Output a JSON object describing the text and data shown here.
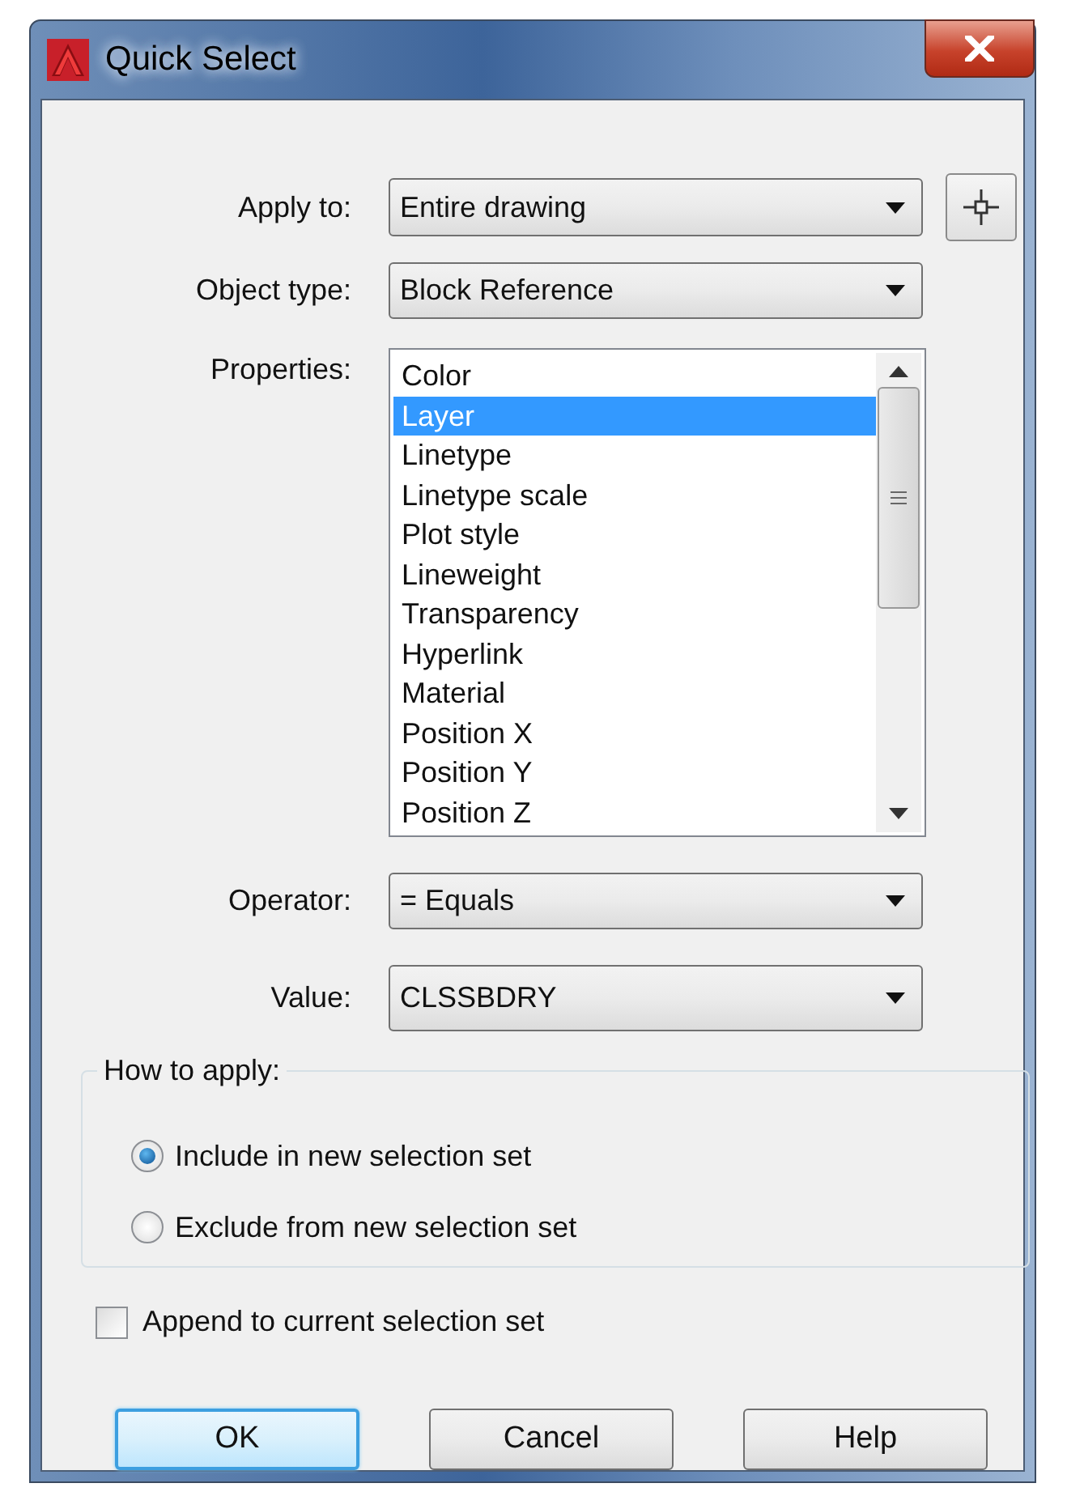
{
  "window": {
    "title": "Quick Select"
  },
  "apply_to": {
    "label": "Apply to:",
    "value": "Entire drawing"
  },
  "object_type": {
    "label": "Object type:",
    "value": "Block Reference"
  },
  "properties": {
    "label": "Properties:",
    "items": [
      {
        "text": "Color",
        "selected": false
      },
      {
        "text": "Layer",
        "selected": true
      },
      {
        "text": "Linetype",
        "selected": false
      },
      {
        "text": "Linetype scale",
        "selected": false
      },
      {
        "text": "Plot style",
        "selected": false
      },
      {
        "text": "Lineweight",
        "selected": false
      },
      {
        "text": "Transparency",
        "selected": false
      },
      {
        "text": "Hyperlink",
        "selected": false
      },
      {
        "text": "Material",
        "selected": false
      },
      {
        "text": "Position X",
        "selected": false
      },
      {
        "text": "Position Y",
        "selected": false
      },
      {
        "text": "Position Z",
        "selected": false
      }
    ]
  },
  "operator": {
    "label": "Operator:",
    "value": "= Equals"
  },
  "value": {
    "label": "Value:",
    "value": "CLSSBDRY"
  },
  "how_to_apply": {
    "title": "How to apply:",
    "options": [
      {
        "label": "Include in new selection set",
        "selected": true
      },
      {
        "label": "Exclude from new selection set",
        "selected": false
      }
    ]
  },
  "append": {
    "label": "Append to current selection set",
    "checked": false
  },
  "buttons": [
    {
      "label": "OK",
      "default": true
    },
    {
      "label": "Cancel",
      "default": false
    },
    {
      "label": "Help",
      "default": false
    }
  ]
}
